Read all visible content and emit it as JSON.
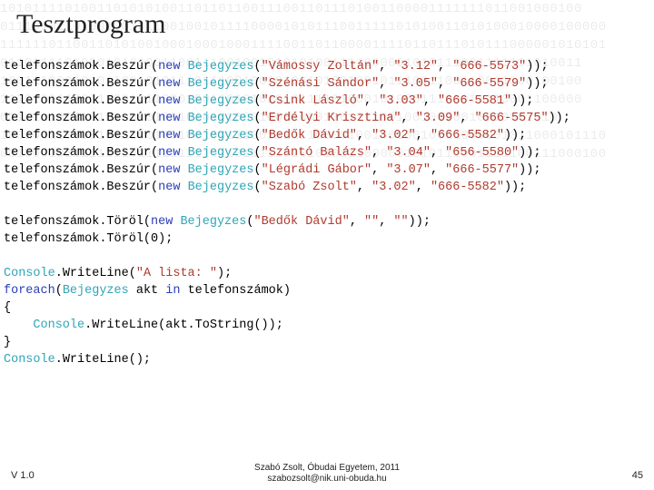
{
  "title": "Tesztprogram",
  "code": {
    "insert_var": "telefonszámok",
    "insert_method": "Beszúr",
    "newkw": "new",
    "ctype": "Bejegyzes",
    "rows": [
      {
        "name": "Vámossy Zoltán",
        "room": "3.12",
        "phone": "666-5573"
      },
      {
        "name": "Szénási Sándor",
        "room": "3.05",
        "phone": "666-5579"
      },
      {
        "name": "Csink László",
        "room": "3.03",
        "phone": "666-5581"
      },
      {
        "name": "Erdélyi Krisztina",
        "room": "3.09",
        "phone": "666-5575"
      },
      {
        "name": "Bedők Dávid",
        "room": "3.02",
        "phone": "666-5582"
      },
      {
        "name": "Szántó Balázs",
        "room": "3.04",
        "phone": "656-5580"
      },
      {
        "name": "Légrádi Gábor",
        "room": "3.07",
        "phone": "666-5577"
      },
      {
        "name": "Szabó Zsolt",
        "room": "3.02",
        "phone": "666-5582"
      }
    ],
    "del1_name": "Bedők Dávid",
    "del1_room": "",
    "del1_phone": "",
    "del2_index": "0",
    "write_label": "A lista: ",
    "foreach_kw": "foreach",
    "in_kw": "in",
    "akt": "akt",
    "collection": "telefonszámok",
    "console": "Console",
    "writeline": "WriteLine",
    "tostring": "ToString",
    "torol": "Töröl"
  },
  "footer": {
    "left": "V 1.0",
    "center_line1": "Szabó Zsolt, Óbudai Egyetem, 2011",
    "center_line2": "szabozsolt@nik.uni-obuda.hu",
    "right": "45"
  },
  "bg": "101011110100110101010011011011001110011011101001100001111111011001000100\n011101011010010010110010010111100001010111001111101010011010100010000100000\n111111011001101010010001000100011110011011000011110110111010111000001010101\n011011110100010101001100111001001010101001111000001010111001111101010011\n100111000101011001010111011100100101001010010010111001100110011000100100\n111010011001110010110001001101010101011110100010100011100011110001100000\n011111100110101000010010101010001000100011011110010010010010010001010\n100100110000100110010010010011100111111000010010010010011000001011000101110\n001000101111111101111111110110111110101010111000001010111001111100111000100"
}
